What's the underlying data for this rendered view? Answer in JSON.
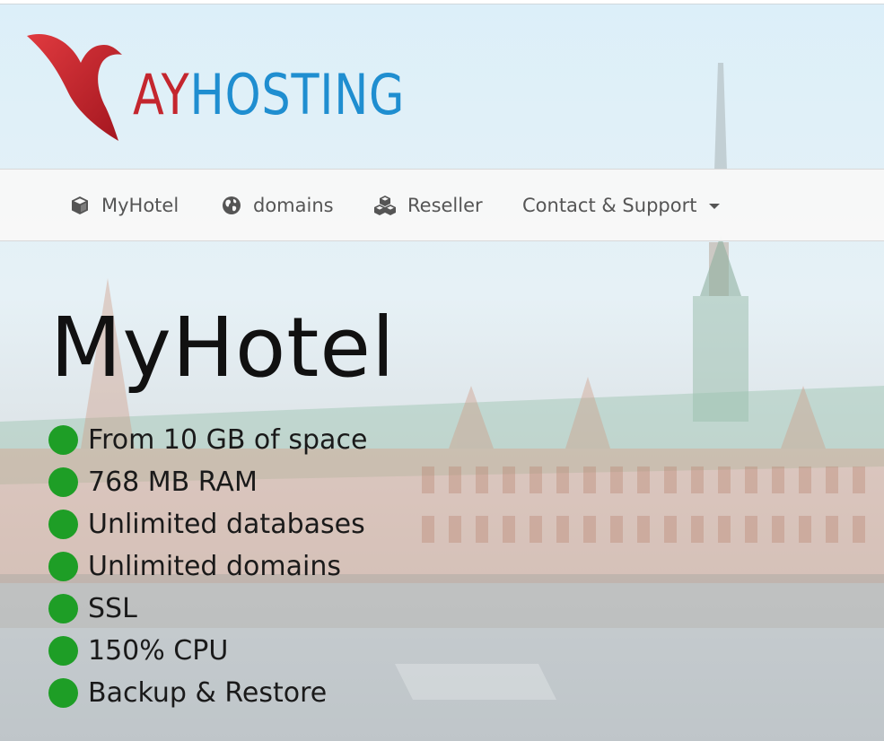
{
  "brand": {
    "logo_text_part1": "AY",
    "logo_text_part2": "HOSTING",
    "logo_color_red": "#c4262e",
    "logo_color_blue": "#1f8ed0"
  },
  "nav": {
    "items": [
      {
        "label": "MyHotel",
        "icon": "cube-icon"
      },
      {
        "label": "domains",
        "icon": "globe-icon"
      },
      {
        "label": "Reseller",
        "icon": "cubes-icon"
      },
      {
        "label": "Contact & Support",
        "icon": "caret-down-icon"
      }
    ]
  },
  "hero": {
    "title": "MyHotel",
    "features": [
      "From 10 GB of space",
      "768 MB RAM",
      "Unlimited databases",
      "Unlimited domains",
      "SSL",
      "150% CPU",
      "Backup & Restore"
    ],
    "bullet_color": "#1e9e26"
  }
}
